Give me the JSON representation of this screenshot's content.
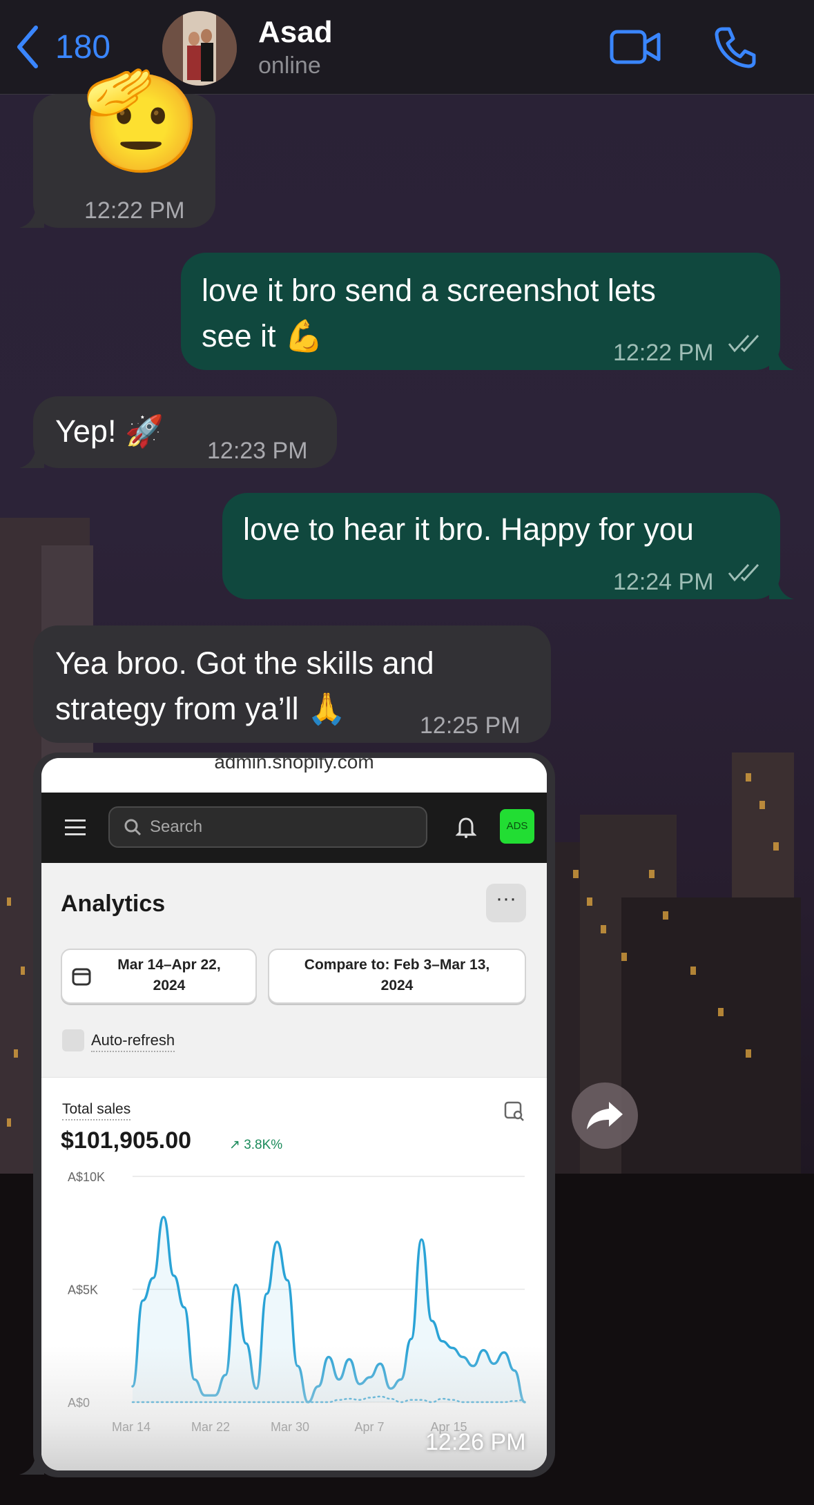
{
  "header": {
    "back_count": "180",
    "contact_name": "Asad",
    "contact_status": "online",
    "video_icon": "video-camera-icon",
    "call_icon": "phone-icon"
  },
  "messages": [
    {
      "direction": "incoming",
      "type": "emoji",
      "emoji": "🫡",
      "time": "12:22 PM"
    },
    {
      "direction": "outgoing",
      "lines": [
        "love it bro send a screenshot lets",
        "see it 💪"
      ],
      "time": "12:22 PM",
      "status": "read"
    },
    {
      "direction": "incoming",
      "lines": [
        "Yep! 🚀"
      ],
      "time": "12:23 PM"
    },
    {
      "direction": "outgoing",
      "lines": [
        "love to hear it bro. Happy for you"
      ],
      "time": "12:24 PM",
      "status": "read"
    },
    {
      "direction": "incoming",
      "lines": [
        "Yea broo. Got the skills and",
        "strategy from ya’ll 🙏"
      ],
      "time": "12:25 PM"
    },
    {
      "direction": "incoming",
      "type": "image",
      "time": "12:26 PM"
    }
  ],
  "screenshot": {
    "url": "admin.shopify.com",
    "search_placeholder": "Search",
    "avatar_badge": "ADS",
    "title": "Analytics",
    "more_label": "···",
    "date_range_line1": "Mar 14–Apr 22,",
    "date_range_line2": "2024",
    "compare_line1": "Compare to: Feb 3–Mar 13,",
    "compare_line2": "2024",
    "auto_refresh_label": "Auto-refresh",
    "total_sales_label": "Total sales",
    "total_sales_value": "$101,905.00",
    "total_sales_change": "↗ 3.8K%"
  },
  "chart_data": {
    "type": "line",
    "x_tick_labels": [
      "Mar 14",
      "Mar 22",
      "Mar 30",
      "Apr 7",
      "Apr 15"
    ],
    "y_tick_labels": [
      "A$10K",
      "A$5K",
      "A$0"
    ],
    "ylim": [
      0,
      10000
    ],
    "series": [
      {
        "color": "#2aa3d6",
        "style": "solid",
        "values": [
          700,
          4500,
          5500,
          8200,
          5600,
          4200,
          1000,
          300,
          300,
          1200,
          5200,
          2600,
          600,
          4800,
          7100,
          5400,
          1600,
          0,
          700,
          2000,
          1000,
          1900,
          800,
          1100,
          1700,
          600,
          1000,
          2800,
          7200,
          3600,
          2700,
          2400,
          2000,
          1600,
          2300,
          1700,
          2200,
          1400,
          0
        ],
        "color_name": "blue"
      },
      {
        "color": "#2aa3d6",
        "style": "dotted",
        "values": [
          0,
          0,
          0,
          0,
          0,
          0,
          0,
          0,
          0,
          0,
          0,
          0,
          0,
          0,
          0,
          0,
          0,
          0,
          0,
          0,
          100,
          150,
          100,
          200,
          250,
          150,
          0,
          100,
          100,
          0,
          150,
          100,
          0,
          0,
          0,
          0,
          0,
          50,
          100
        ],
        "color_name": "blue"
      }
    ]
  }
}
